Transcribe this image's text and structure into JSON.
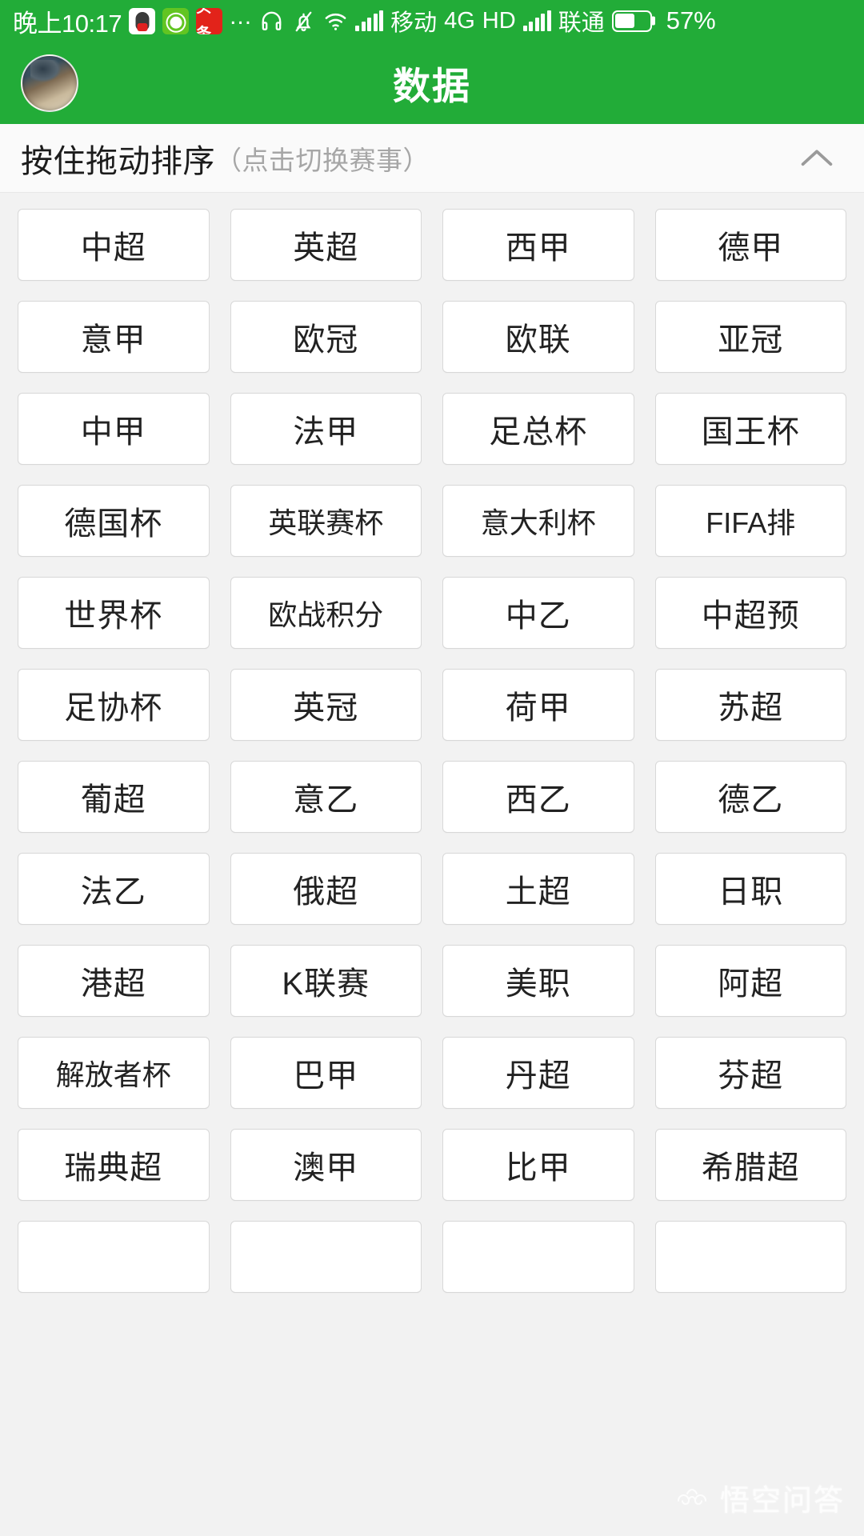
{
  "statusbar": {
    "time": "晚上10:17",
    "app_icons": [
      "qq-icon",
      "wechat-green-icon",
      "toutiao-icon"
    ],
    "more_dots": "...",
    "headphone_icon": "headphone-icon",
    "mute_bell_icon": "bell-muted-icon",
    "wifi_icon": "wifi-icon",
    "carrier_1": "移动",
    "network_type": "4G",
    "hd_label": "HD",
    "carrier_2": "联通",
    "battery_percent": "57%",
    "battery_level": 57
  },
  "header": {
    "title": "数据",
    "avatar": "user-avatar"
  },
  "sortbar": {
    "main_text": "按住拖动排序",
    "sub_text": "（点击切换赛事）",
    "collapse_icon": "chevron-up-icon"
  },
  "grid": {
    "columns": 4,
    "leagues": [
      "中超",
      "英超",
      "西甲",
      "德甲",
      "意甲",
      "欧冠",
      "欧联",
      "亚冠",
      "中甲",
      "法甲",
      "足总杯",
      "国王杯",
      "德国杯",
      "英联赛杯",
      "意大利杯",
      "FIFA排",
      "世界杯",
      "欧战积分",
      "中乙",
      "中超预",
      "足协杯",
      "英冠",
      "荷甲",
      "苏超",
      "葡超",
      "意乙",
      "西乙",
      "德乙",
      "法乙",
      "俄超",
      "土超",
      "日职",
      "港超",
      "K联赛",
      "美职",
      "阿超",
      "解放者杯",
      "巴甲",
      "丹超",
      "芬超",
      "瑞典超",
      "澳甲",
      "比甲",
      "希腊超",
      "",
      "",
      "",
      ""
    ]
  },
  "watermark": {
    "text": "悟空问答",
    "logo": "wukong-logo-icon"
  },
  "colors": {
    "brand_green": "#22ac38",
    "page_background": "#f2f2f2",
    "card_background": "#ffffff",
    "card_border": "#d8d8d8",
    "primary_text": "#1c1c1c",
    "muted_text": "#a6a6a6"
  }
}
